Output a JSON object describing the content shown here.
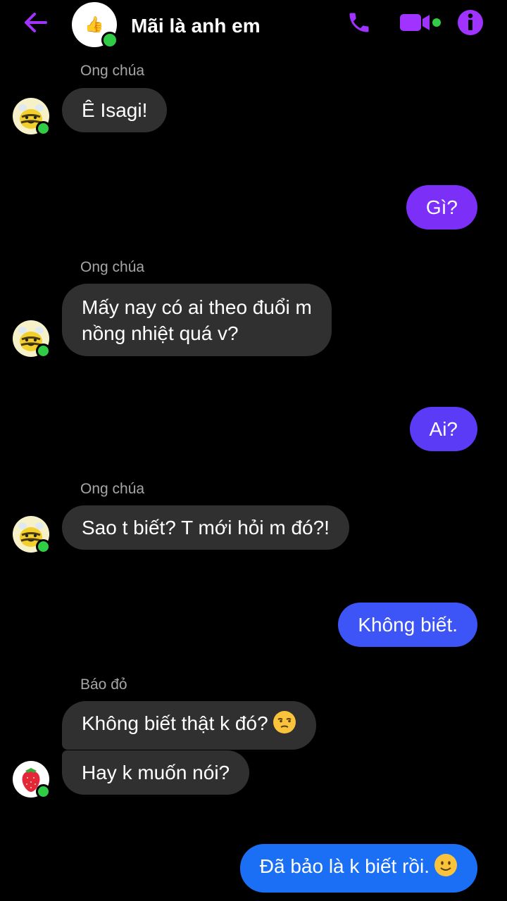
{
  "header": {
    "title": "Mãi là anh em",
    "group_avatar_glyph": "👍",
    "accent_color": "#a033ff",
    "online_color": "#31cc46"
  },
  "messages": [
    {
      "sender": "Ong chúa",
      "text": "Ê Isagi!"
    },
    {
      "text": "Gì?",
      "color": "#7b2ff7"
    },
    {
      "sender": "Ong chúa",
      "line1": "Mấy nay có ai theo đuổi m",
      "line2": "nồng nhiệt quá v?"
    },
    {
      "text": "Ai?",
      "color": "#5b3bf5"
    },
    {
      "sender": "Ong chúa",
      "text": "Sao t biết? T mới hỏi m đó?!"
    },
    {
      "text": "Không biết.",
      "color": "#3d54f7"
    },
    {
      "sender": "Báo đỏ",
      "text": "Không biết thật k đó?",
      "emoji": "unamused-face"
    },
    {
      "text": "Hay k muốn nói?"
    },
    {
      "text": "Đã bảo là k biết rồi.",
      "emoji": "slightly-smiling-face",
      "color": "#1b6ff5"
    }
  ]
}
